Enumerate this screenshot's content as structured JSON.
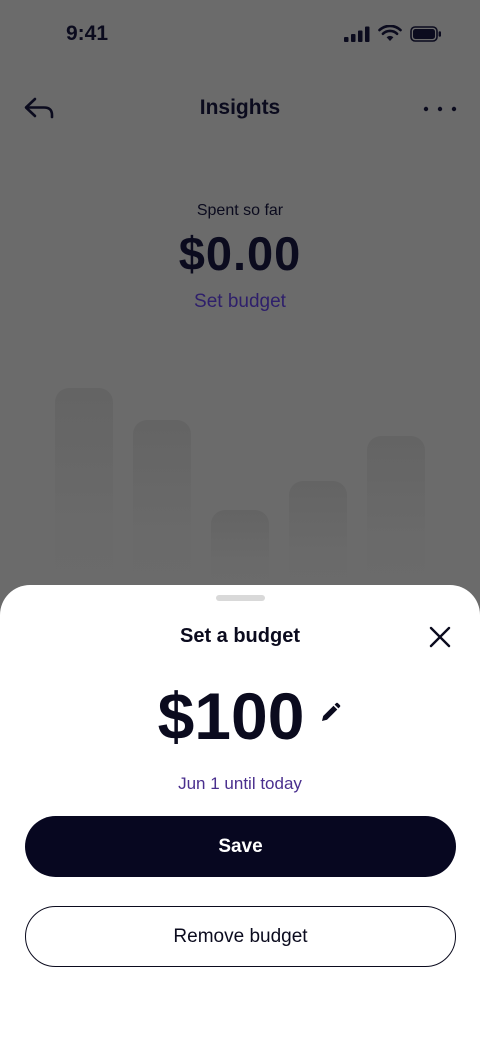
{
  "status_bar": {
    "time": "9:41"
  },
  "header": {
    "title": "Insights",
    "back_icon": "back-arrow-icon",
    "more_icon": "more-dots-icon"
  },
  "summary": {
    "label": "Spent so far",
    "value": "$0.00",
    "set_budget_link": "Set budget"
  },
  "chart_placeholder": {
    "bar_count": 5
  },
  "sheet": {
    "title": "Set a budget",
    "amount": "$100",
    "date_range": "Jun 1 until today",
    "save_label": "Save",
    "remove_label": "Remove budget",
    "close_icon": "close-icon",
    "edit_icon": "pencil-icon"
  },
  "colors": {
    "primary_dark": "#070720",
    "accent_purple": "#4a2f8e",
    "overlay": "#6b6b6b",
    "sheet_bg": "#ffffff"
  }
}
